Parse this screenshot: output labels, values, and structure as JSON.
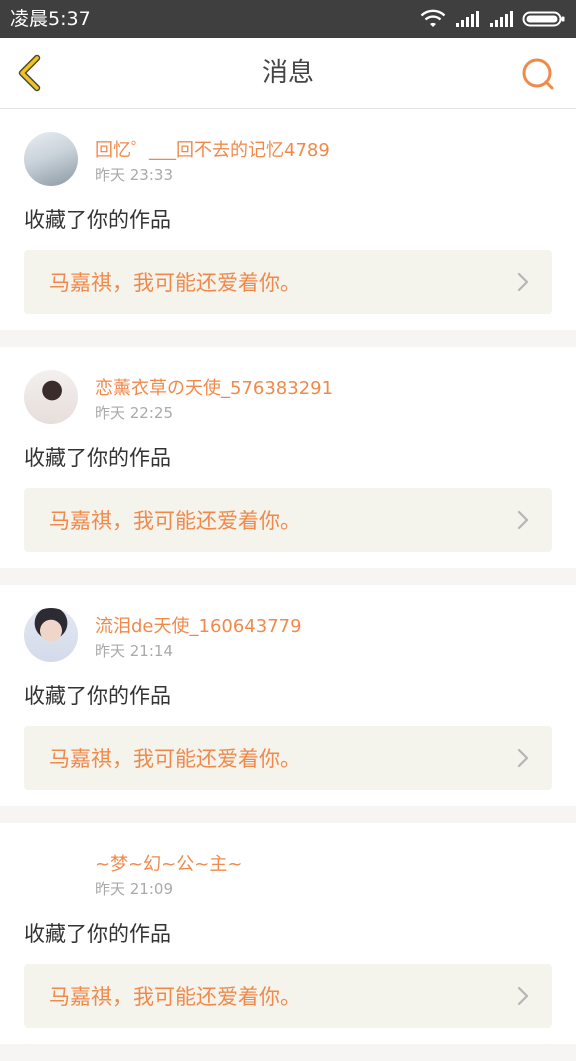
{
  "status_bar": {
    "time": "凌晨5:37"
  },
  "header": {
    "title": "消息"
  },
  "colors": {
    "accent": "#f08a4b",
    "back_icon": "#f0c419",
    "status_bg": "#3f3f3f",
    "work_box_bg": "#f4f3ec"
  },
  "icons": {
    "back": "chevron-left-icon",
    "search": "search-icon",
    "item_arrow": "chevron-right-icon"
  },
  "messages": [
    {
      "username": "回忆゜___回不去的记忆4789",
      "time": "昨天 23:33",
      "action": "收藏了你的作品",
      "work_title": "马嘉祺，我可能还爱着你。"
    },
    {
      "username": "恋薰衣草の天使_576383291",
      "time": "昨天 22:25",
      "action": "收藏了你的作品",
      "work_title": "马嘉祺，我可能还爱着你。"
    },
    {
      "username": "流泪de天使_160643779",
      "time": "昨天 21:14",
      "action": "收藏了你的作品",
      "work_title": "马嘉祺，我可能还爱着你。"
    },
    {
      "username": "~梦~幻~公~主~",
      "time": "昨天 21:09",
      "action": "收藏了你的作品",
      "work_title": "马嘉祺，我可能还爱着你。"
    }
  ]
}
